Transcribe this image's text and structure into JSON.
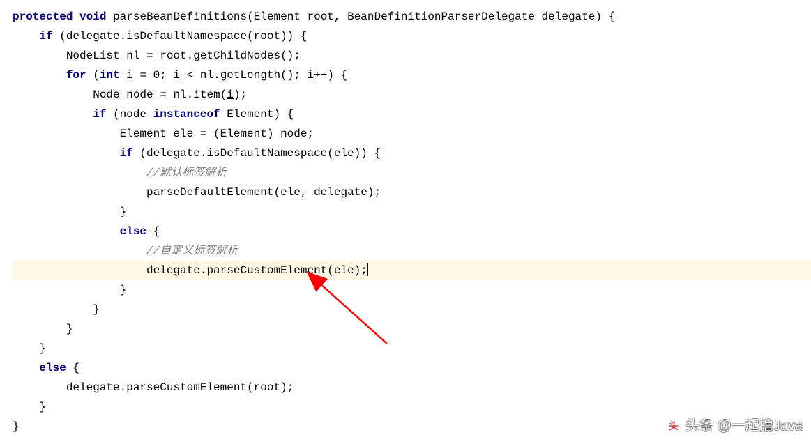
{
  "code": {
    "line1": {
      "kw_protected": "protected",
      "kw_void": "void",
      "method": "parseBeanDefinitions",
      "params": "(Element root, BeanDefinitionParserDelegate delegate) {"
    },
    "line2": {
      "kw_if": "if",
      "rest": " (delegate.isDefaultNamespace(root)) {"
    },
    "line3": "        NodeList nl = root.getChildNodes();",
    "line4": {
      "indent": "        ",
      "kw_for": "for",
      "p1": " (",
      "kw_int": "int",
      "sp1": " ",
      "v1": "i",
      "p2": " = ",
      "num0": "0",
      "p3": "; ",
      "v2": "i",
      "p4": " < nl.getLength(); ",
      "v3": "i",
      "p5": "++) {"
    },
    "line5": {
      "pre": "            Node node = nl.item(",
      "v": "i",
      "post": ");"
    },
    "line6": {
      "indent": "            ",
      "kw_if": "if",
      "p1": " (node ",
      "kw_instanceof": "instanceof",
      "p2": " Element) {"
    },
    "line7": "                Element ele = (Element) node;",
    "line8": {
      "indent": "                ",
      "kw_if": "if",
      "rest": " (delegate.isDefaultNamespace(ele)) {"
    },
    "line9": "                    //默认标签解析",
    "line10": "                    parseDefaultElement(ele, delegate);",
    "line11": "                }",
    "line12": {
      "indent": "                ",
      "kw_else": "else",
      "rest": " {"
    },
    "line13": "                    //自定义标签解析",
    "line14": "                    delegate.parseCustomElement(ele);",
    "line15": "                }",
    "line16": "            }",
    "line17": "        }",
    "line18": "    }",
    "line19": {
      "indent": "    ",
      "kw_else": "else",
      "rest": " {"
    },
    "line20": "        delegate.parseCustomElement(root);",
    "line21": "    }",
    "line22": "}"
  },
  "watermark": {
    "logo_text": "头",
    "text": "头条 @一起撸Java"
  }
}
